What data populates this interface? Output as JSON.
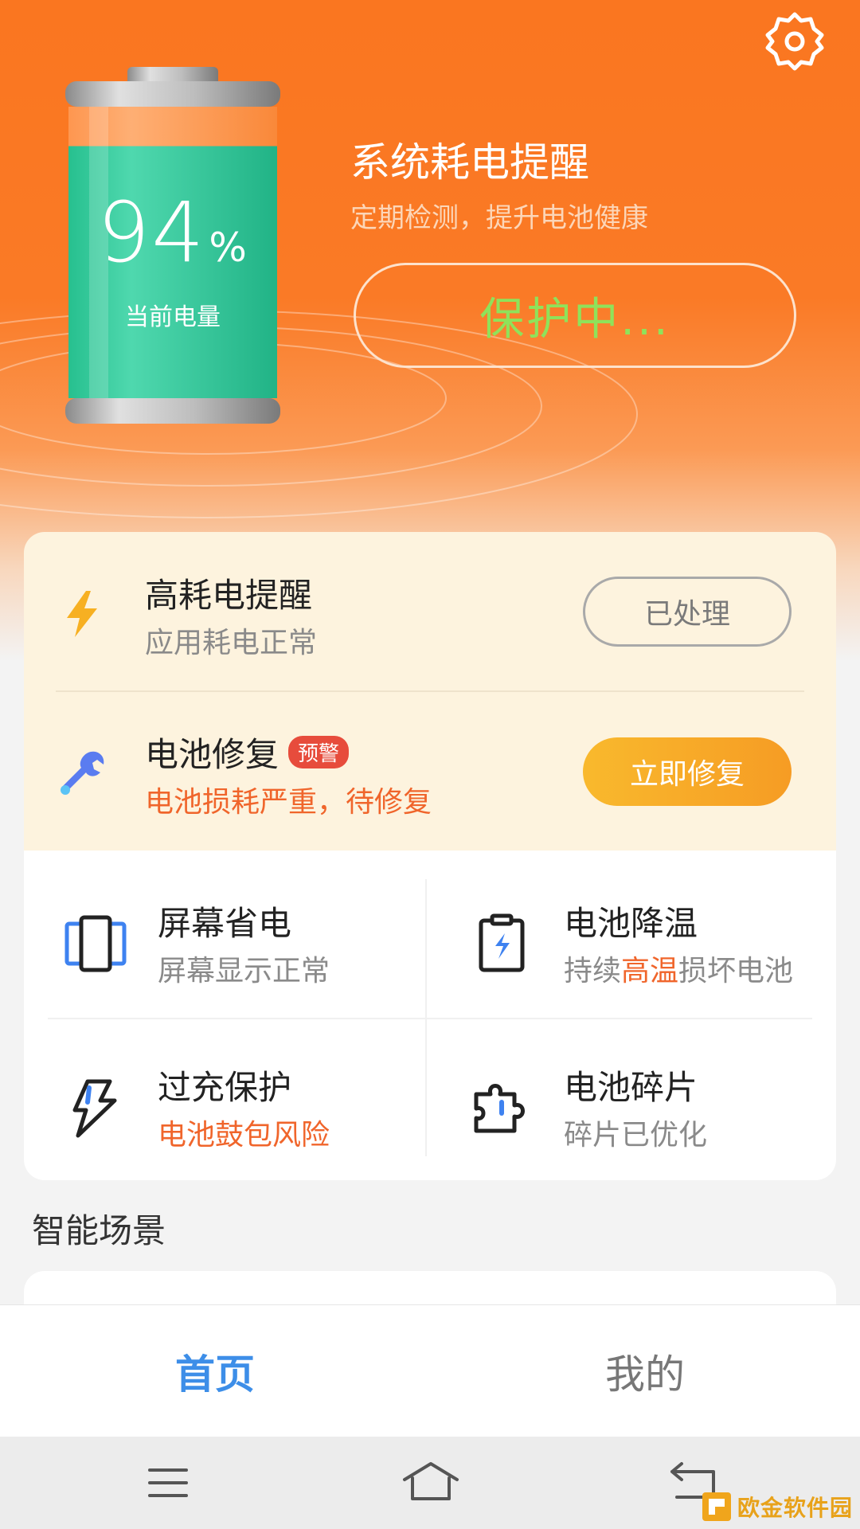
{
  "hero": {
    "battery_percent": "94",
    "battery_percent_sign": "%",
    "battery_level": 0.94,
    "battery_label": "当前电量",
    "title": "系统耗电提醒",
    "subtitle": "定期检测，提升电池健康",
    "protect_button": "保护中..."
  },
  "alerts": [
    {
      "title": "高耗电提醒",
      "subtitle": "应用耗电正常",
      "button": "已处理",
      "icon": "lightning-icon"
    },
    {
      "title": "电池修复",
      "badge": "预警",
      "subtitle": "电池损耗严重，待修复",
      "button": "立即修复",
      "icon": "wrench-icon"
    }
  ],
  "features": [
    {
      "title": "屏幕省电",
      "subtitle": "屏幕显示正常",
      "icon": "phone-screen-icon"
    },
    {
      "title": "电池降温",
      "subtitle_pre": "持续",
      "subtitle_highlight": "高温",
      "subtitle_post": "损坏电池",
      "icon": "battery-cool-icon"
    },
    {
      "title": "过充保护",
      "subtitle": "电池鼓包风险",
      "icon": "overcharge-bolt-icon"
    },
    {
      "title": "电池碎片",
      "subtitle": "碎片已优化",
      "icon": "puzzle-icon"
    }
  ],
  "section": {
    "title": "智能场景"
  },
  "tabs": [
    {
      "label": "首页",
      "active": true
    },
    {
      "label": "我的",
      "active": false
    }
  ],
  "system_nav": [
    "menu-icon",
    "home-icon",
    "back-icon"
  ],
  "watermark": {
    "text": "欧金软件园"
  },
  "colors": {
    "hero_orange": "#fa7620",
    "battery_green": "#2fc99a",
    "protect_green": "#8fe25a",
    "warn_orange": "#f0652b",
    "fix_button": "#f7a928",
    "tab_active": "#3d8ee8"
  }
}
